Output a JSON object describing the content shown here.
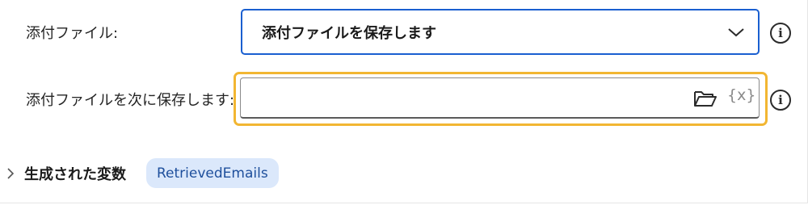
{
  "attachments": {
    "label": "添付ファイル:",
    "selected_value": "添付ファイルを保存します",
    "dropdown_icon": "chevron-down-icon",
    "info_icon": "info-icon"
  },
  "save_to": {
    "label": "添付ファイルを次に保存します:",
    "value": "",
    "folder_icon": "folder-open-icon",
    "variable_icon_text": "{x}",
    "info_icon": "info-icon",
    "focus_color": "#f2b632"
  },
  "generated_variables": {
    "title": "生成された変数",
    "expander_icon": "chevron-right-icon",
    "variables": [
      "RetrievedEmails"
    ]
  },
  "colors": {
    "accent": "#1a5fd0",
    "chip_background": "#dbe8fb",
    "chip_text": "#1e4f9c"
  }
}
